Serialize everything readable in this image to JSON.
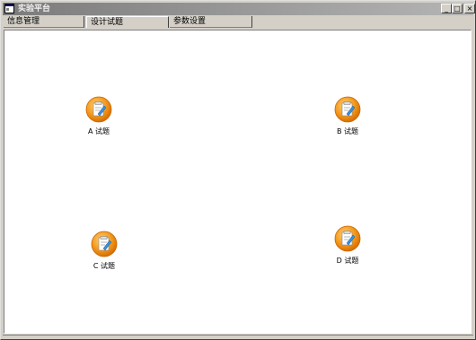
{
  "window": {
    "title": "实验平台",
    "minimize_label": "_",
    "maximize_label": "□",
    "close_label": "×"
  },
  "tabs": [
    {
      "label": "信息管理"
    },
    {
      "label": "设计试题"
    },
    {
      "label": "参数设置"
    }
  ],
  "exams": [
    {
      "label": "A 试题",
      "icon": "edit-document-icon"
    },
    {
      "label": "B 试题",
      "icon": "edit-document-icon"
    },
    {
      "label": "C 试题",
      "icon": "edit-document-icon"
    },
    {
      "label": "D 试题",
      "icon": "edit-document-icon"
    }
  ],
  "colors": {
    "titlebar_start": "#7b7b7b",
    "titlebar_end": "#b5b5b5",
    "icon_orange": "#f39a1e",
    "face": "#d4d0c8"
  }
}
